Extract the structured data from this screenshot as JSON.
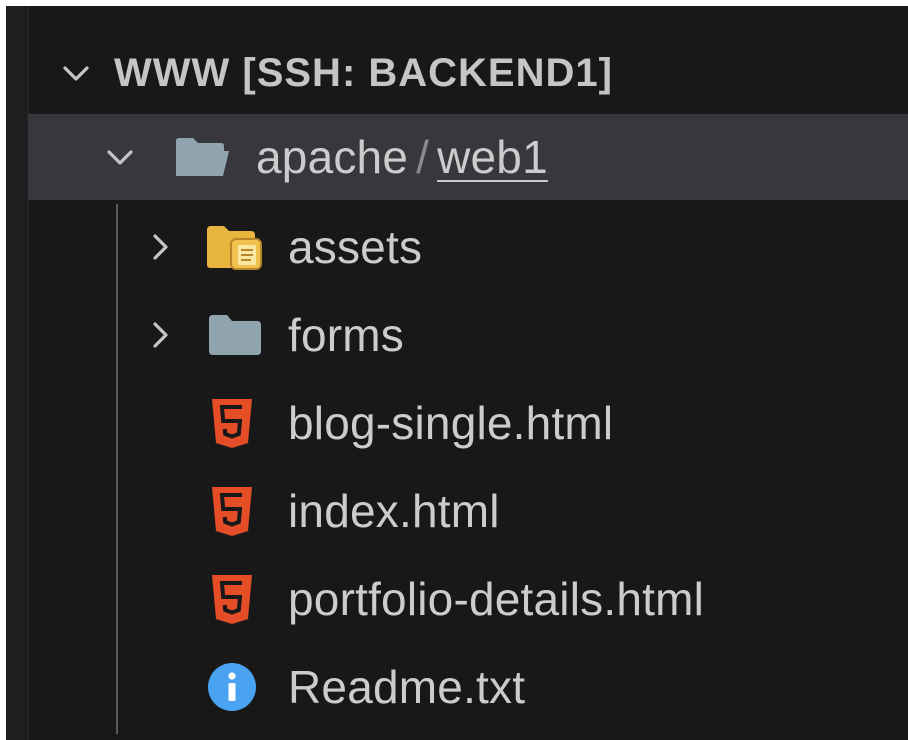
{
  "explorer": {
    "section_title": "WWW [SSH: BACKEND1]",
    "folder_path": {
      "parent": "apache",
      "separator": "/",
      "current": "web1"
    },
    "items": [
      {
        "label": "assets",
        "icon": "folder-assets-icon",
        "expandable": true
      },
      {
        "label": "forms",
        "icon": "folder-icon",
        "expandable": true
      },
      {
        "label": "blog-single.html",
        "icon": "html5-icon",
        "expandable": false
      },
      {
        "label": "index.html",
        "icon": "html5-icon",
        "expandable": false
      },
      {
        "label": "portfolio-details.html",
        "icon": "html5-icon",
        "expandable": false
      },
      {
        "label": "Readme.txt",
        "icon": "info-icon",
        "expandable": false
      }
    ]
  },
  "colors": {
    "background": "#181818",
    "selected_row": "#37373d",
    "text": "#cccccc",
    "html_icon": "#e44d26",
    "assets_folder": "#e8b53e",
    "folder": "#90a4ae",
    "info_icon": "#4aa3f0"
  }
}
